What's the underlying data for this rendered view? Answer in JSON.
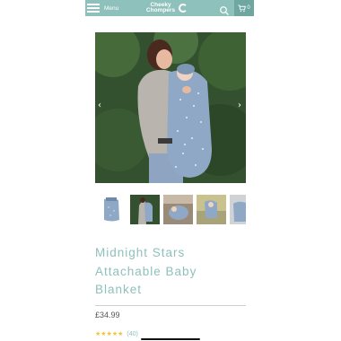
{
  "header": {
    "menu_label": "Menu",
    "logo_line1": "Cheeky",
    "logo_line2": "Chompers",
    "cart_count": "0"
  },
  "icons": {
    "menu": "hamburger-icon",
    "search": "search-icon",
    "cart": "cart-icon",
    "prev": "chevron-left-icon",
    "next": "chevron-right-icon"
  },
  "colors": {
    "brand": "#8ec1bb",
    "brand_dark": "#6fa6a0",
    "star": "#f2c23a",
    "price_text": "#555555"
  },
  "carousel": {
    "prev_glyph": "‹",
    "next_glyph": "›"
  },
  "product": {
    "title_line1": "Midnight Stars",
    "title_line2": "Attachable Baby",
    "title_line3": "Blanket",
    "price": "£34.99",
    "stars": "★★★★★",
    "rating_value": 5,
    "review_count": "(40)"
  }
}
